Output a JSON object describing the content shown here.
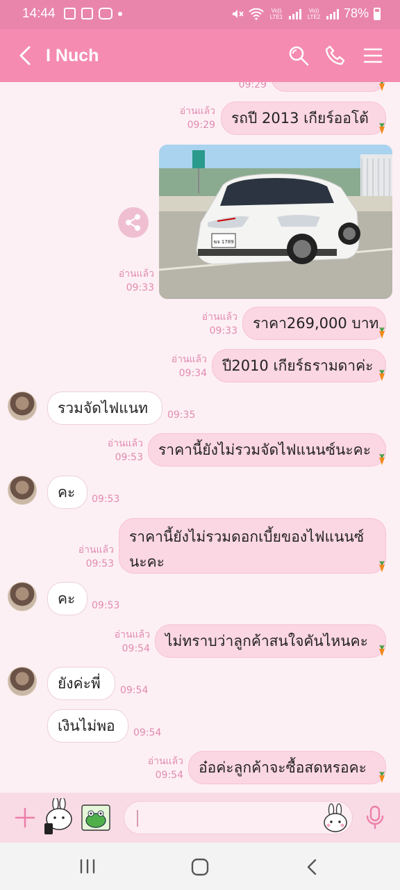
{
  "status_bar": {
    "time": "14:44",
    "lte1": "Vo)) LTE1",
    "lte2": "Vo)) LTE2",
    "battery": "78%"
  },
  "header": {
    "title": "I Nuch",
    "icons": [
      "back-icon",
      "search-icon",
      "phone-icon",
      "menu-icon"
    ]
  },
  "chat": {
    "top_clipped_time": "09:29",
    "messages": [
      {
        "dir": "out",
        "text": "รถปี 2013 เกียร์ออโต้",
        "read": "อ่านแล้ว",
        "time": "09:29"
      },
      {
        "dir": "out",
        "type": "image",
        "read": "อ่านแล้ว",
        "time": "09:33",
        "plate": "ฆจ 1789"
      },
      {
        "dir": "out",
        "text": "ราคา269,000 บาท",
        "read": "อ่านแล้ว",
        "time": "09:33"
      },
      {
        "dir": "out",
        "text": "ปี2010 เกียร์ธรามดาค่ะ",
        "read": "อ่านแล้ว",
        "time": "09:34"
      },
      {
        "dir": "in",
        "text": "รวมจัดไฟแนท",
        "time": "09:35"
      },
      {
        "dir": "out",
        "text": "ราคานี้ยังไม่รวมจัดไฟแนนซ์นะคะ",
        "read": "อ่านแล้ว",
        "time": "09:53"
      },
      {
        "dir": "in",
        "text": "คะ",
        "time": "09:53"
      },
      {
        "dir": "out",
        "text_line1": "ราคานี้ยังไม่รวมดอกเบี้ยของไฟแนนซ์",
        "text_line2": "นะคะ",
        "read": "อ่านแล้ว",
        "time": "09:53"
      },
      {
        "dir": "in",
        "text": "คะ",
        "time": "09:53"
      },
      {
        "dir": "out",
        "text": "ไม่ทราบว่าลูกค้าสนใจคันไหนคะ",
        "read": "อ่านแล้ว",
        "time": "09:54"
      },
      {
        "dir": "in",
        "text": "ยังค่ะพี่",
        "time": "09:54"
      },
      {
        "dir": "in",
        "text": "เงินไม่พอ",
        "time": "09:54"
      },
      {
        "dir": "out",
        "text": "อ๋อค่ะลูกค้าจะซื้อสดหรอคะ",
        "read": "อ่านแล้ว",
        "time": "09:54"
      }
    ]
  },
  "input_bar": {
    "icons": [
      "plus-icon",
      "sticker-icon",
      "frog-sticker-icon",
      "emoji-icon",
      "mic-icon"
    ],
    "placeholder": ""
  },
  "nav_bar": {
    "icons": [
      "recent-apps-icon",
      "home-icon",
      "back-nav-icon"
    ]
  },
  "colors": {
    "header": "#f58bb0",
    "status_bar": "#e985ab",
    "bubble_out": "#fbd6e3",
    "bubble_in": "#ffffff",
    "meta_text": "#e18ab0",
    "background": "#fdf0f4"
  }
}
